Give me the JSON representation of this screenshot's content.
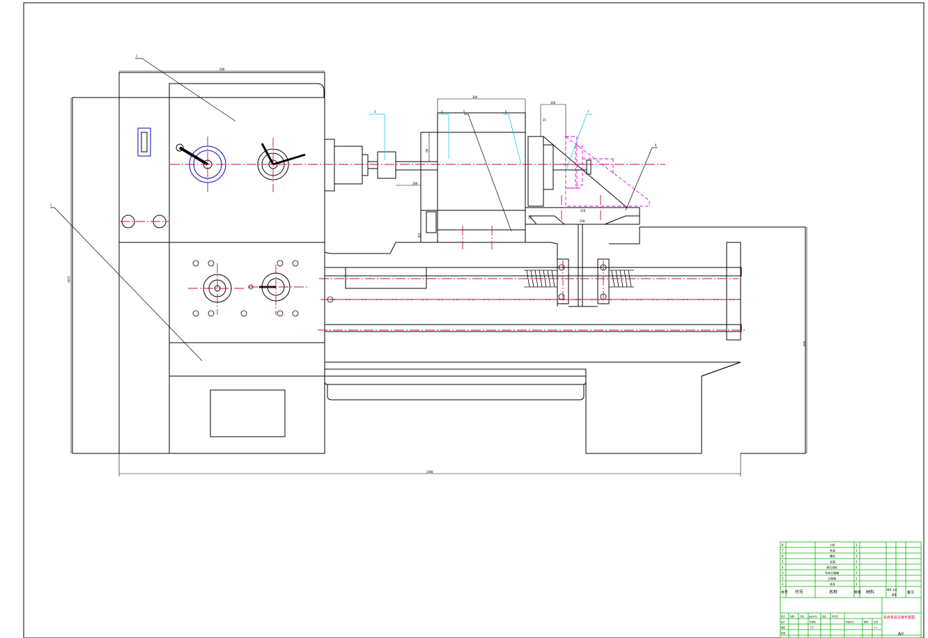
{
  "drawing": {
    "title_block": {
      "drawing_title": "车床夹具总装布置图",
      "sheet_size": "A0",
      "header": {
        "seq": "序号",
        "code": "代号",
        "name": "名称",
        "qty": "数量",
        "material": "材料",
        "unit_total_weight": "单件 总计",
        "weight": "重量",
        "remarks": "备注"
      },
      "parts_list": [
        {
          "no": "8",
          "name": "刀杆",
          "qty": "1"
        },
        {
          "no": "7",
          "name": "夹具",
          "qty": "1"
        },
        {
          "no": "6",
          "name": "螺杆",
          "qty": "1"
        },
        {
          "no": "5",
          "name": "支架",
          "qty": "1"
        },
        {
          "no": "4",
          "name": "液压油缸",
          "qty": "1"
        },
        {
          "no": "3",
          "name": "车床主轴箱",
          "qty": "1"
        },
        {
          "no": "2",
          "name": "主轴箱",
          "qty": "1"
        },
        {
          "no": "1",
          "name": "床身",
          "qty": "1"
        }
      ],
      "signoff": {
        "mark": "标记",
        "count": "处数",
        "zone": "分区",
        "change_doc": "更改文件号",
        "signature": "签名",
        "date": "年月日",
        "design": "设计",
        "standardization": "标准化",
        "stage_mark": "阶段标记",
        "weight_label": "重量",
        "scale": "比例",
        "review": "审核",
        "process": "工艺",
        "approve": "批准",
        "scale_value": "1:5"
      }
    },
    "balloons": [
      "1",
      "2",
      "3",
      "4",
      "5",
      "6",
      "7",
      "8"
    ],
    "dimensions": {
      "headstock_width": "580",
      "overall_length": "2400",
      "overall_height": "1200",
      "bed_height": "800",
      "fixture_width": "300",
      "clamp_width": "160",
      "shaft_len": "188",
      "tool_w": "80",
      "small_a": "25",
      "small_b": "150",
      "small_c": "24",
      "small_d": "320",
      "small_e": "240"
    },
    "colors": {
      "line": "#000000",
      "centerline": "#d4003a",
      "leader_cyan": "#00c8c8",
      "handwheel": "#0000cc",
      "phantom": "#e000e0",
      "titleblock": "#00b000"
    }
  }
}
